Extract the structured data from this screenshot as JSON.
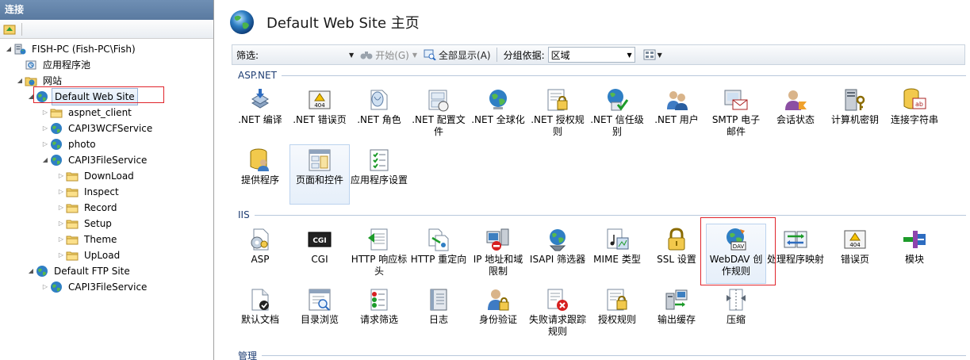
{
  "connections": {
    "title": "连接",
    "tree": [
      {
        "label": "FISH-PC (Fish-PC\\Fish)",
        "icon": "server-icon",
        "expander": "expanded"
      },
      {
        "label": "应用程序池",
        "icon": "app-pool-icon",
        "expander": "none"
      },
      {
        "label": "网站",
        "icon": "sites-folder-icon",
        "expander": "expanded"
      },
      {
        "label": "Default Web Site",
        "icon": "globe-icon",
        "expander": "expanded",
        "selected": true
      },
      {
        "label": "aspnet_client",
        "icon": "folder-icon",
        "expander": "collapsed"
      },
      {
        "label": "CAPI3WCFService",
        "icon": "globe-icon",
        "expander": "collapsed"
      },
      {
        "label": "photo",
        "icon": "globe-icon",
        "expander": "collapsed"
      },
      {
        "label": "CAPI3FileService",
        "icon": "globe-icon",
        "expander": "expanded"
      },
      {
        "label": "DownLoad",
        "icon": "folder-icon",
        "expander": "collapsed"
      },
      {
        "label": "Inspect",
        "icon": "folder-icon",
        "expander": "collapsed"
      },
      {
        "label": "Record",
        "icon": "folder-icon",
        "expander": "collapsed"
      },
      {
        "label": "Setup",
        "icon": "folder-icon",
        "expander": "collapsed"
      },
      {
        "label": "Theme",
        "icon": "folder-icon",
        "expander": "collapsed"
      },
      {
        "label": "UpLoad",
        "icon": "folder-icon",
        "expander": "collapsed"
      },
      {
        "label": "Default FTP Site",
        "icon": "globe-icon",
        "expander": "expanded"
      },
      {
        "label": "CAPI3FileService",
        "icon": "globe-icon",
        "expander": "collapsed"
      }
    ]
  },
  "main": {
    "title": "Default Web Site 主页",
    "filter_bar": {
      "filter_label": "筛选:",
      "filter_value": "",
      "go_label": "开始(G)",
      "show_all_label": "全部显示(A)",
      "group_by_label": "分组依据:",
      "group_by_value": "区域"
    },
    "sections": [
      {
        "name": "ASP.NET",
        "features": [
          {
            "label": ".NET 编译",
            "icon": "net-compilation-icon"
          },
          {
            "label": ".NET 错误页",
            "icon": "net-error-pages-icon"
          },
          {
            "label": ".NET 角色",
            "icon": "net-roles-icon"
          },
          {
            "label": ".NET 配置文件",
            "icon": "net-profile-icon"
          },
          {
            "label": ".NET 全球化",
            "icon": "net-globalization-icon"
          },
          {
            "label": ".NET 授权规则",
            "icon": "net-authorization-rules-icon"
          },
          {
            "label": ".NET 信任级别",
            "icon": "net-trust-levels-icon"
          },
          {
            "label": ".NET 用户",
            "icon": "net-users-icon"
          },
          {
            "label": "SMTP 电子邮件",
            "icon": "smtp-email-icon"
          },
          {
            "label": "会话状态",
            "icon": "session-state-icon"
          },
          {
            "label": "计算机密钥",
            "icon": "machine-key-icon"
          },
          {
            "label": "连接字符串",
            "icon": "connection-strings-icon"
          },
          {
            "label": "提供程序",
            "icon": "providers-icon"
          },
          {
            "label": "页面和控件",
            "icon": "pages-controls-icon",
            "hover": true
          },
          {
            "label": "应用程序设置",
            "icon": "app-settings-icon"
          }
        ]
      },
      {
        "name": "IIS",
        "features": [
          {
            "label": "ASP",
            "icon": "asp-icon"
          },
          {
            "label": "CGI",
            "icon": "cgi-icon"
          },
          {
            "label": "HTTP 响应标头",
            "icon": "http-response-headers-icon"
          },
          {
            "label": "HTTP 重定向",
            "icon": "http-redirect-icon"
          },
          {
            "label": "IP 地址和域限制",
            "icon": "ip-domain-restrictions-icon"
          },
          {
            "label": "ISAPI 筛选器",
            "icon": "isapi-filters-icon"
          },
          {
            "label": "MIME 类型",
            "icon": "mime-types-icon"
          },
          {
            "label": "SSL 设置",
            "icon": "ssl-settings-icon"
          },
          {
            "label": "WebDAV 创作规则",
            "icon": "webdav-icon",
            "hover": true
          },
          {
            "label": "处理程序映射",
            "icon": "handler-mappings-icon"
          },
          {
            "label": "错误页",
            "icon": "error-pages-icon"
          },
          {
            "label": "模块",
            "icon": "modules-icon"
          },
          {
            "label": "默认文档",
            "icon": "default-document-icon"
          },
          {
            "label": "目录浏览",
            "icon": "directory-browsing-icon"
          },
          {
            "label": "请求筛选",
            "icon": "request-filtering-icon"
          },
          {
            "label": "日志",
            "icon": "logging-icon"
          },
          {
            "label": "身份验证",
            "icon": "authentication-icon"
          },
          {
            "label": "失败请求跟踪规则",
            "icon": "failed-request-tracing-icon"
          },
          {
            "label": "授权规则",
            "icon": "authorization-rules-icon"
          },
          {
            "label": "输出缓存",
            "icon": "output-caching-icon"
          },
          {
            "label": "压缩",
            "icon": "compression-icon"
          }
        ]
      },
      {
        "name": "管理",
        "features": []
      }
    ]
  },
  "colors": {
    "highlight_box": "#e0242b",
    "section_text": "#1e3d73",
    "header_bg": "#6583a9"
  }
}
